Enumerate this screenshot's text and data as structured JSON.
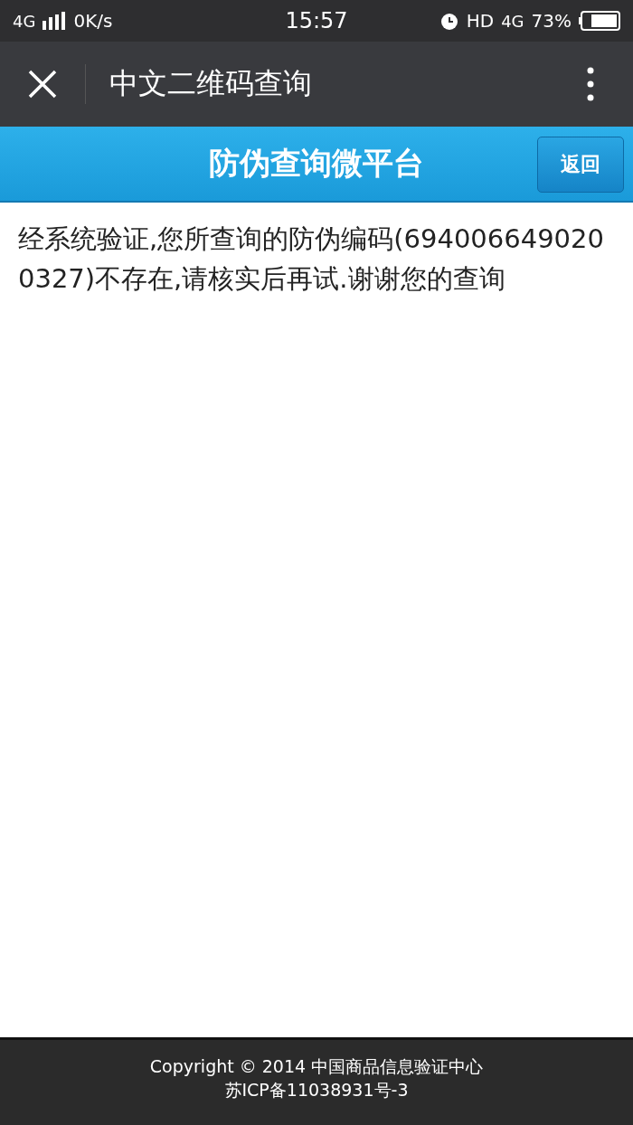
{
  "status_bar": {
    "network": "4G",
    "speed": "0K/s",
    "time": "15:57",
    "hd": "HD",
    "data_network": "4G",
    "battery": "73%"
  },
  "nav_bar": {
    "title": "中文二维码查询"
  },
  "header": {
    "title": "防伪查询微平台",
    "back_button": "返回"
  },
  "message": "经系统验证,您所查询的防伪编码(6940066490200327)不存在,请核实后再试.谢谢您的查询",
  "footer": {
    "lines": [
      "Copyright © 2014 中国商品信息验证中心",
      "苏ICP备11038931号-3"
    ]
  }
}
